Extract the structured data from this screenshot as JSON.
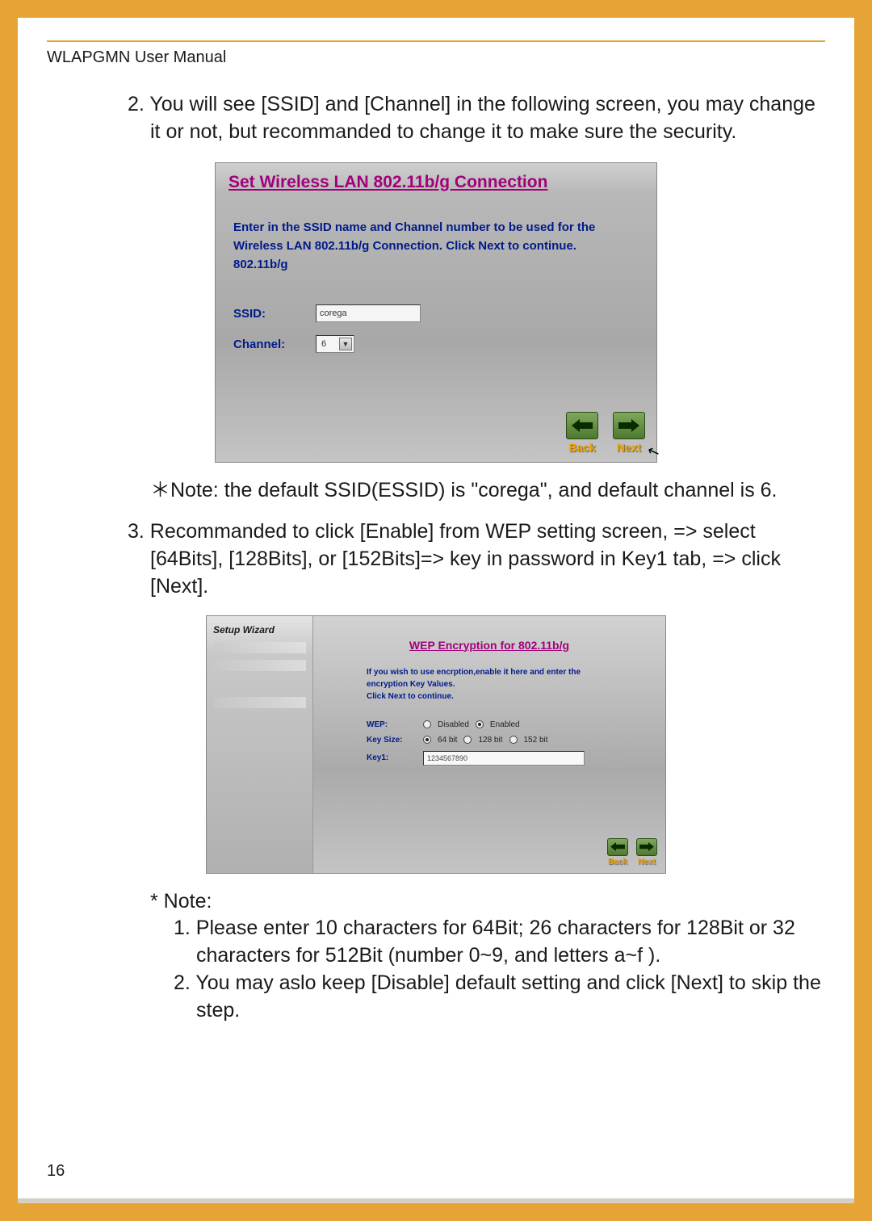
{
  "header": {
    "title": "WLAPGMN User Manual"
  },
  "step2": {
    "text": "2. You will see [SSID] and [Channel] in the following screen, you may change it or not, but recommanded to change it to make sure the security."
  },
  "shot1": {
    "title": "Set Wireless LAN 802.11b/g Connection",
    "instr1": "Enter in the SSID name and Channel number to be used for the",
    "instr2": "Wireless LAN 802.11b/g Connection. Click Next to continue.",
    "instr3": "802.11b/g",
    "ssid_label": "SSID:",
    "ssid_value": "corega",
    "channel_label": "Channel:",
    "channel_value": "6",
    "back": "Back",
    "next": "Next"
  },
  "note1": "＊Note: the default SSID(ESSID) is \"corega\", and default channel is 6.",
  "step3": {
    "text": "3. Recommanded to click [Enable] from WEP setting screen, => select [64Bits], [128Bits], or [152Bits]=> key in password in Key1 tab, => click [Next]."
  },
  "shot2": {
    "sidebar": "Setup Wizard",
    "title": "WEP Encryption for 802.11b/g",
    "instr1": "If you wish to use encrption,enable it here and enter the",
    "instr2": "encryption Key Values.",
    "instr3": "Click Next to continue.",
    "wep_label": "WEP:",
    "wep_disabled": "Disabled",
    "wep_enabled": "Enabled",
    "ks_label": "Key Size:",
    "ks_64": "64 bit",
    "ks_128": "128 bit",
    "ks_152": "152 bit",
    "key1_label": "Key1:",
    "key1_value": "1234567890",
    "back": "Back",
    "next": "Next"
  },
  "note_end": {
    "head": "* Note:",
    "n1": "1. Please enter 10 characters for 64Bit; 26 characters for 128Bit or 32 characters for 512Bit (number 0~9, and letters a~f ).",
    "n2": "2. You may aslo keep [Disable] default setting and click [Next] to skip the step."
  },
  "page_number": "16"
}
